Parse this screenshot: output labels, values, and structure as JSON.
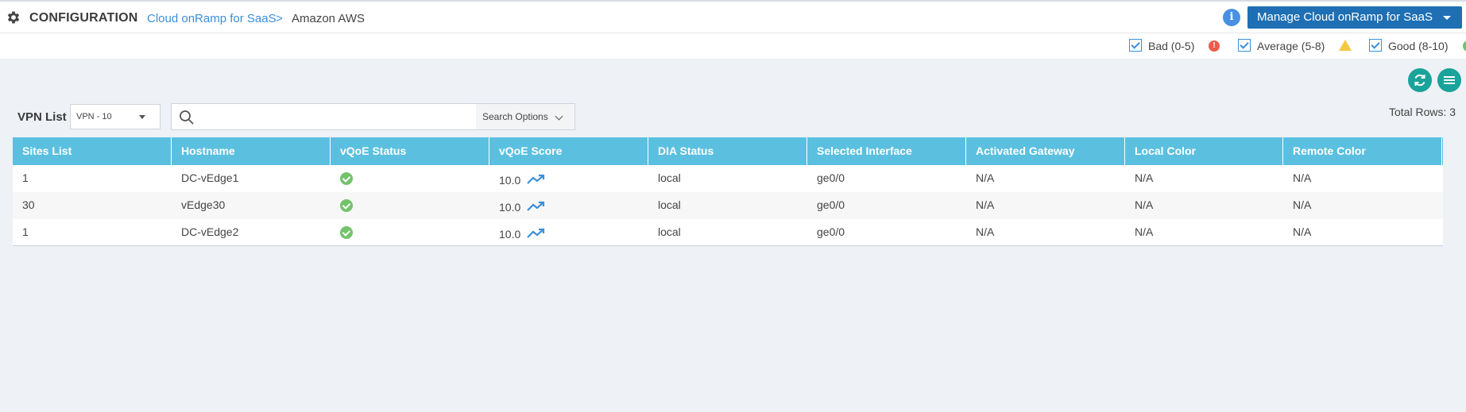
{
  "header": {
    "title": "CONFIGURATION",
    "breadcrumb": [
      "Cloud onRamp for SaaS",
      "Amazon AWS"
    ],
    "breadcrumb_separator": ">",
    "info_label": "i",
    "manage_button": "Manage Cloud onRamp for SaaS"
  },
  "legend": {
    "bad": "Bad (0-5)",
    "bad_icon": "!",
    "average": "Average (5-8)",
    "good": "Good (8-10)",
    "colors": {
      "bad": "#ef5b4b",
      "average": "#f5c842",
      "good": "#6cc36c"
    }
  },
  "toolbar": {
    "vpn_label": "VPN List",
    "vpn_selected": "VPN - 10",
    "search_placeholder": "",
    "search_options": "Search Options",
    "total_rows": "Total Rows: 3"
  },
  "table": {
    "columns": [
      "Sites List",
      "Hostname",
      "vQoE Status",
      "vQoE Score",
      "DIA Status",
      "Selected Interface",
      "Activated Gateway",
      "Local Color",
      "Remote Color"
    ],
    "rows": [
      {
        "site": "1",
        "hostname": "DC-vEdge1",
        "vqoe_status": "good",
        "vqoe_score": "10.0",
        "dia_status": "local",
        "interface": "ge0/0",
        "gateway": "N/A",
        "local_color": "N/A",
        "remote_color": "N/A"
      },
      {
        "site": "30",
        "hostname": "vEdge30",
        "vqoe_status": "good",
        "vqoe_score": "10.0",
        "dia_status": "local",
        "interface": "ge0/0",
        "gateway": "N/A",
        "local_color": "N/A",
        "remote_color": "N/A"
      },
      {
        "site": "1",
        "hostname": "DC-vEdge2",
        "vqoe_status": "good",
        "vqoe_score": "10.0",
        "dia_status": "local",
        "interface": "ge0/0",
        "gateway": "N/A",
        "local_color": "N/A",
        "remote_color": "N/A"
      }
    ]
  },
  "icons": {
    "settings": "gear-icon",
    "refresh": "refresh-icon",
    "menu": "menu-icon",
    "search": "search-icon",
    "trend": "trend-up-icon",
    "status": "check-circle-icon"
  },
  "accent": "#1e6fb3",
  "header_color": "#5bc0e0"
}
